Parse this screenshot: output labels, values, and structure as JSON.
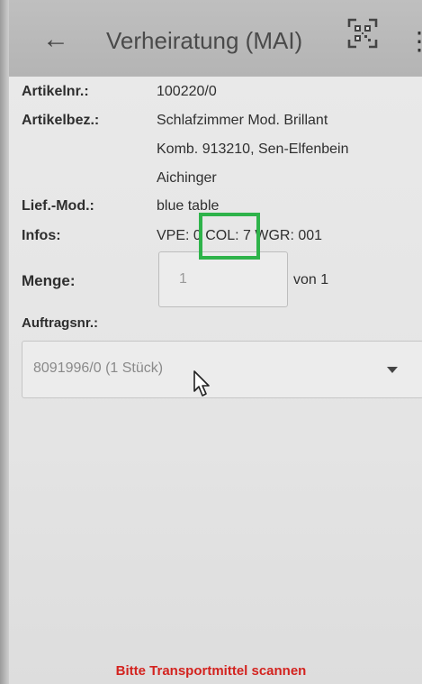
{
  "appbar": {
    "back_icon": "arrow-left-icon",
    "title": "Verheiratung (MAI)",
    "qr_icon": "qr-code-scan-icon",
    "more_icon": "more-vert-icon",
    "back_glyph": "←",
    "more_glyph": "⋮"
  },
  "details": {
    "artikelnr_label": "Artikelnr.:",
    "artikelnr_value": "100220/0",
    "artikelbez_label": "Artikelbez.:",
    "artikelbez_line1": "Schlafzimmer Mod. Brillant",
    "artikelbez_line2": "Komb. 913210, Sen-Elfenbein",
    "artikelbez_line3": "Aichinger",
    "liefmod_label": "Lief.-Mod.:",
    "liefmod_value": "blue table",
    "infos_label": "Infos:",
    "infos_value": "VPE: 0 COL: 7 WGR: 001"
  },
  "menge": {
    "label": "Menge:",
    "value": "1",
    "von_text": "von 1"
  },
  "auftrag": {
    "label": "Auftragsnr.:",
    "selected": "8091996/0 (1 Stück)"
  },
  "footer": {
    "message": "Bitte Transportmittel scannen"
  },
  "colors": {
    "appbar": "#b8b8b8",
    "background": "#e7e7e7",
    "highlight": "#2eb34a",
    "footer_text": "#d3231f"
  }
}
